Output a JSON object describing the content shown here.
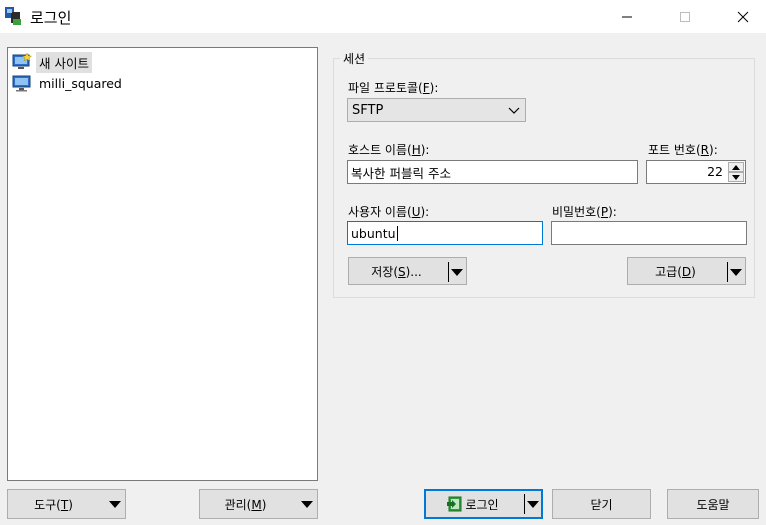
{
  "window": {
    "title": "로그인"
  },
  "tree": {
    "items": [
      {
        "label": "새 사이트",
        "icon": "new-site-icon",
        "selected": true
      },
      {
        "label": "milli_squared",
        "icon": "computer-icon",
        "selected": false
      }
    ]
  },
  "session": {
    "group_title": "세션",
    "protocol_label": "파일 프로토콜(",
    "protocol_key": "F",
    "protocol_suffix": "):",
    "protocol_value": "SFTP",
    "host_label": "호스트 이름(",
    "host_key": "H",
    "host_suffix": "):",
    "host_value": "복사한 퍼블릭 주소",
    "port_label": "포트 번호(",
    "port_key": "R",
    "port_suffix": "):",
    "port_value": "22",
    "user_label": "사용자 이름(",
    "user_key": "U",
    "user_suffix": "):",
    "user_value": "ubuntu",
    "password_label": "비밀번호(",
    "password_key": "P",
    "password_suffix": "):",
    "password_value": "",
    "save_label": "저장(",
    "save_key": "S",
    "save_suffix": ")...",
    "advanced_label": "고급(",
    "advanced_key": "D",
    "advanced_suffix": ")"
  },
  "footer": {
    "tools_label": "도구(",
    "tools_key": "T",
    "tools_suffix": ")",
    "manage_label": "관리(",
    "manage_key": "M",
    "manage_suffix": ")",
    "login_label": "로그인",
    "close_label": "닫기",
    "help_label": "도움말"
  },
  "colors": {
    "accent": "#0078d7",
    "background": "#f0f0f0"
  }
}
